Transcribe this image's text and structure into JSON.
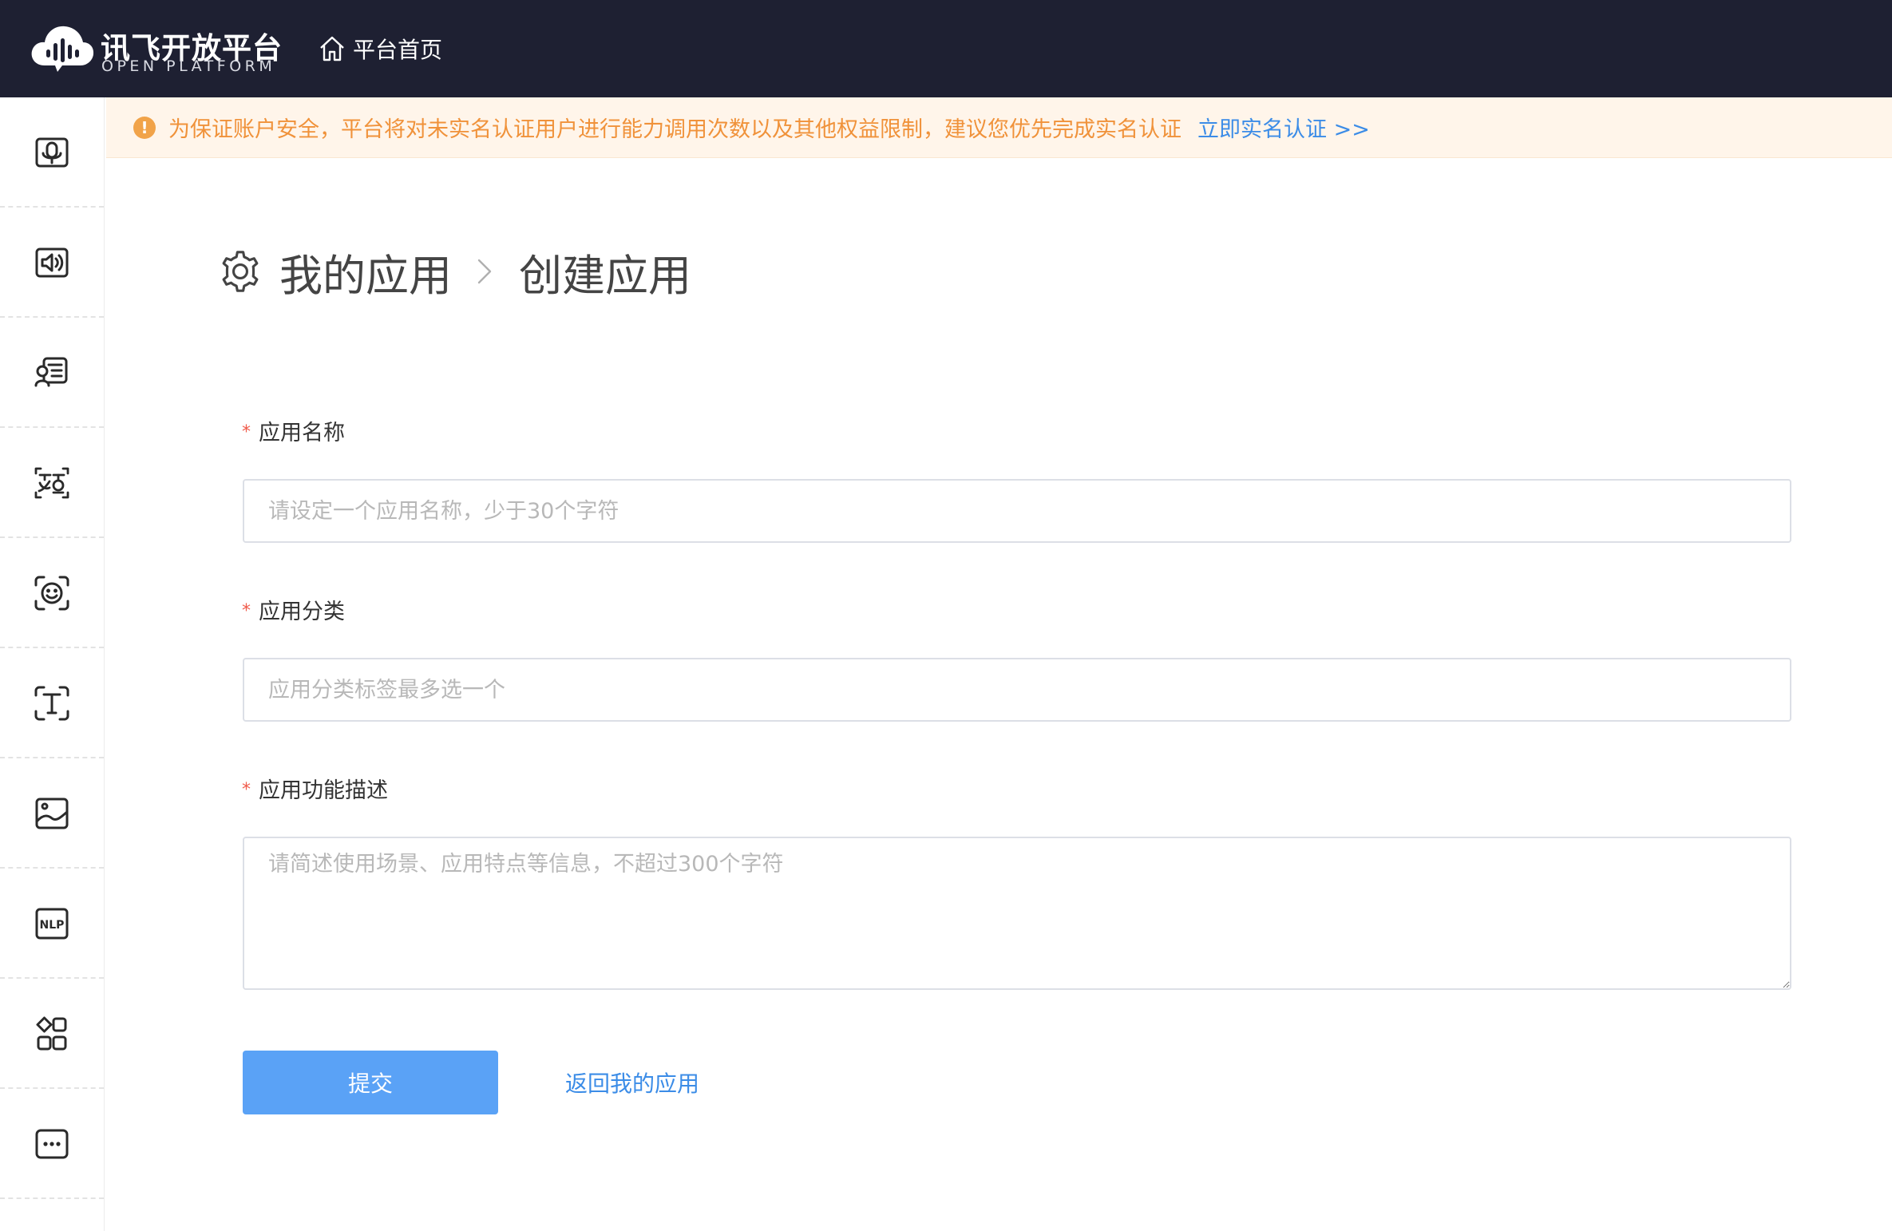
{
  "header": {
    "logo_cn": "讯飞开放平台",
    "logo_en": "OPEN PLATFORM",
    "home_label": "平台首页"
  },
  "sidebar": {
    "items": [
      {
        "icon": "voice-recognition-icon"
      },
      {
        "icon": "speech-synthesis-icon"
      },
      {
        "icon": "voice-dialogue-icon"
      },
      {
        "icon": "translation-icon"
      },
      {
        "icon": "face-recognition-icon"
      },
      {
        "icon": "text-recognition-icon"
      },
      {
        "icon": "image-recognition-icon"
      },
      {
        "icon": "nlp-icon"
      },
      {
        "icon": "apps-grid-icon"
      },
      {
        "icon": "more-icon"
      }
    ]
  },
  "notice": {
    "text": "为保证账户安全，平台将对未实名认证用户进行能力调用次数以及其他权益限制，建议您优先完成实名认证",
    "link": "立即实名认证 >>"
  },
  "breadcrumb": {
    "parent": "我的应用",
    "current": "创建应用"
  },
  "form": {
    "name": {
      "label": "应用名称",
      "required": "*",
      "placeholder": "请设定一个应用名称，少于30个字符",
      "value": ""
    },
    "category": {
      "label": "应用分类",
      "required": "*",
      "placeholder": "应用分类标签最多选一个",
      "value": ""
    },
    "description": {
      "label": "应用功能描述",
      "required": "*",
      "placeholder": "请简述使用场景、应用特点等信息，不超过300个字符",
      "value": ""
    },
    "submit_label": "提交",
    "back_label": "返回我的应用"
  },
  "colors": {
    "header_bg": "#1e2032",
    "notice_bg": "#fff5ea",
    "notice_text": "#f0923a",
    "link": "#3b8ce7",
    "primary_button": "#5aa2f6",
    "required_mark": "#f05a4a"
  }
}
